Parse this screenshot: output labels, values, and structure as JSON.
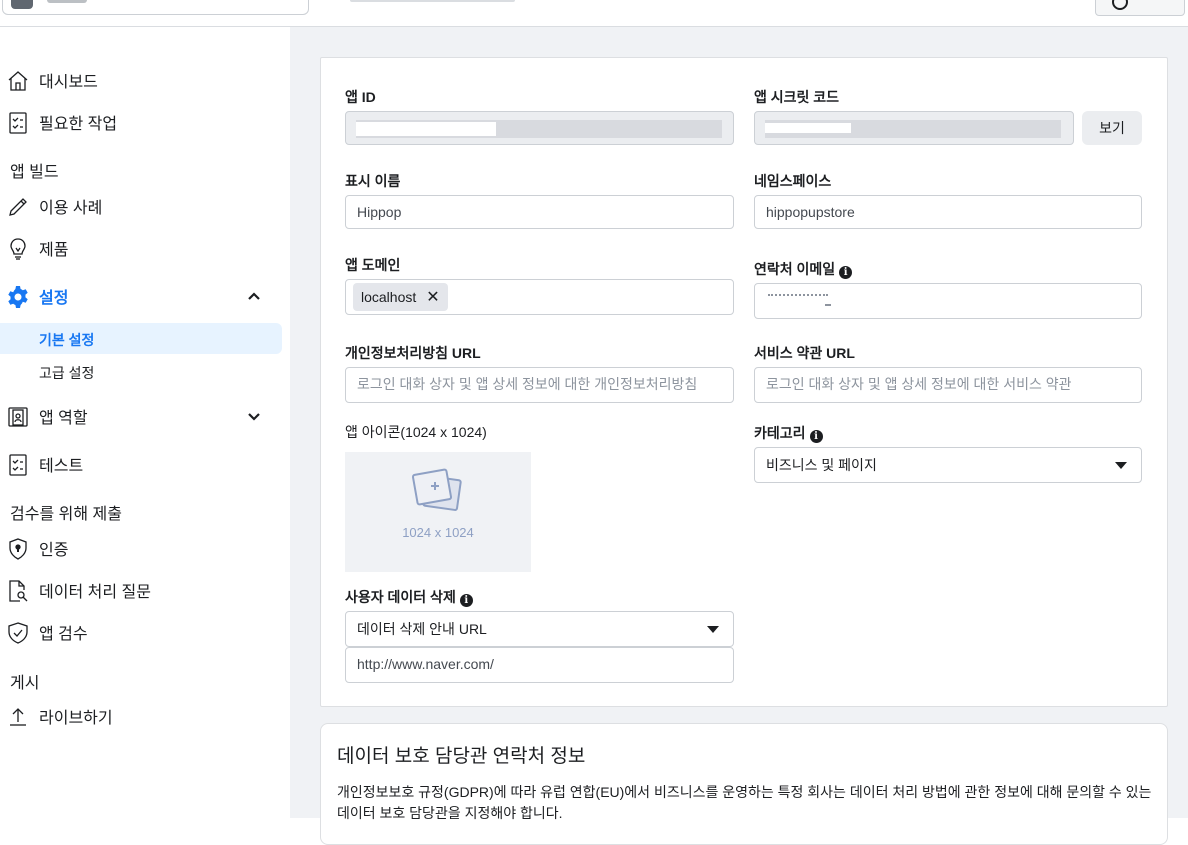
{
  "topbar": {},
  "sidebar": {
    "items": [
      {
        "label": "대시보드"
      },
      {
        "label": "필요한 작업"
      }
    ],
    "section_build": "앱 빌드",
    "build_items": [
      {
        "label": "이용 사례"
      },
      {
        "label": "제품"
      },
      {
        "label": "설정"
      }
    ],
    "settings_sub": [
      {
        "label": "기본 설정"
      },
      {
        "label": "고급 설정"
      }
    ],
    "more_items": [
      {
        "label": "앱 역할"
      },
      {
        "label": "테스트"
      }
    ],
    "section_review": "검수를 위해 제출",
    "review_items": [
      {
        "label": "인증"
      },
      {
        "label": "데이터 처리 질문"
      },
      {
        "label": "앱 검수"
      }
    ],
    "section_publish": "게시",
    "publish_items": [
      {
        "label": "라이브하기"
      }
    ]
  },
  "form": {
    "app_id_label": "앱 ID",
    "app_secret_label": "앱 시크릿 코드",
    "show_button": "보기",
    "display_name_label": "표시 이름",
    "display_name_value": "Hippop",
    "namespace_label": "네임스페이스",
    "namespace_value": "hippopupstore",
    "app_domain_label": "앱 도메인",
    "app_domain_chip": "localhost",
    "contact_email_label": "연락처 이메일",
    "privacy_url_label": "개인정보처리방침 URL",
    "privacy_url_placeholder": "로그인 대화 상자 및 앱 상세 정보에 대한 개인정보처리방침",
    "tos_url_label": "서비스 약관 URL",
    "tos_url_placeholder": "로그인 대화 상자 및 앱 상세 정보에 대한 서비스 약관",
    "app_icon_label": "앱 아이콘(1024 x 1024)",
    "app_icon_size": "1024 x 1024",
    "category_label": "카테고리",
    "category_value": "비즈니스 및 페이지",
    "user_data_deletion_label": "사용자 데이터 삭제",
    "user_data_deletion_select": "데이터 삭제 안내 URL",
    "user_data_deletion_url": "http://www.naver.com/"
  },
  "dpo": {
    "title": "데이터 보호 담당관 연락처 정보",
    "description": "개인정보보호 규정(GDPR)에 따라 유럽 연합(EU)에서 비즈니스를 운영하는 특정 회사는 데이터 처리 방법에 관한 정보에 대해 문의할 수 있는 데이터 보호 담당관을 지정해야 합니다."
  }
}
